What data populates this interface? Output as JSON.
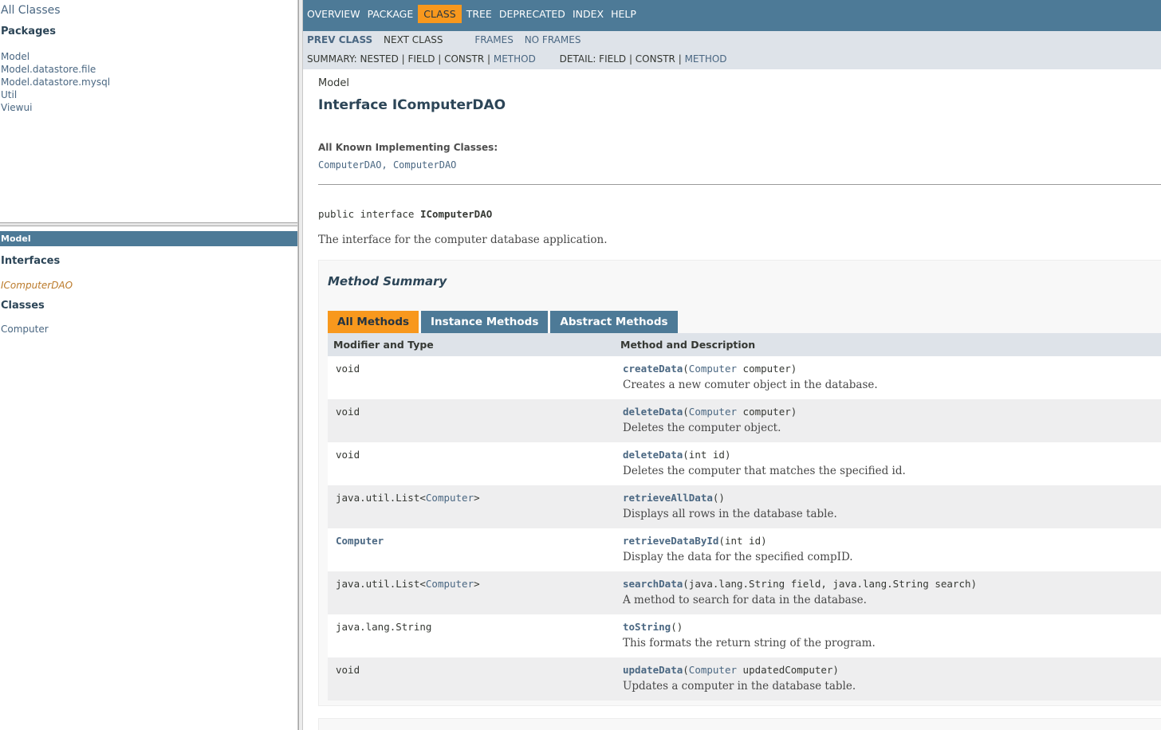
{
  "left": {
    "all_classes": "All Classes",
    "packages_title": "Packages",
    "packages": [
      "Model",
      "Model.datastore.file",
      "Model.datastore.mysql",
      "Util",
      "Viewui"
    ],
    "current_package": "Model",
    "interfaces_title": "Interfaces",
    "interfaces": [
      "IComputerDAO"
    ],
    "classes_title": "Classes",
    "classes": [
      "Computer"
    ]
  },
  "topnav": {
    "items": [
      "OVERVIEW",
      "PACKAGE",
      "CLASS",
      "TREE",
      "DEPRECATED",
      "INDEX",
      "HELP"
    ],
    "active": "CLASS"
  },
  "subnav": {
    "prev_class": "PREV CLASS",
    "next_class": "NEXT CLASS",
    "frames": "FRAMES",
    "no_frames": "NO FRAMES",
    "summary_prefix": "SUMMARY: NESTED | FIELD | CONSTR | ",
    "summary_method": "METHOD",
    "detail_prefix": "DETAIL: FIELD | CONSTR | ",
    "detail_method": "METHOD"
  },
  "header": {
    "package": "Model",
    "title": "Interface IComputerDAO",
    "impl_title": "All Known Implementing Classes:",
    "impl_class_1": "ComputerDAO",
    "impl_sep": ", ",
    "impl_class_2": "ComputerDAO"
  },
  "signature": {
    "prefix": "public interface ",
    "name": "IComputerDAO"
  },
  "description": "The interface for the computer database application.",
  "summary": {
    "title": "Method Summary",
    "tabs": [
      "All Methods",
      "Instance Methods",
      "Abstract Methods"
    ],
    "col_type": "Modifier and Type",
    "col_method": "Method and Description",
    "rows": [
      {
        "type_pre": "void",
        "type_link": "",
        "type_post": "",
        "name": "createData",
        "param_pre": "(",
        "param_link": "Computer",
        "param_post": " computer)",
        "desc": "Creates a new comuter object in the database."
      },
      {
        "type_pre": "void",
        "type_link": "",
        "type_post": "",
        "name": "deleteData",
        "param_pre": "(",
        "param_link": "Computer",
        "param_post": " computer)",
        "desc": "Deletes the computer object."
      },
      {
        "type_pre": "void",
        "type_link": "",
        "type_post": "",
        "name": "deleteData",
        "param_pre": "(int id)",
        "param_link": "",
        "param_post": "",
        "desc": "Deletes the computer that matches the specified id."
      },
      {
        "type_pre": "java.util.List<",
        "type_link": "Computer",
        "type_post": ">",
        "name": "retrieveAllData",
        "param_pre": "()",
        "param_link": "",
        "param_post": "",
        "desc": "Displays all rows in the database table."
      },
      {
        "type_pre": "",
        "type_link": "Computer",
        "type_post": "",
        "name": "retrieveDataById",
        "param_pre": "(int id)",
        "param_link": "",
        "param_post": "",
        "desc": "Display the data for the specified compID."
      },
      {
        "type_pre": "java.util.List<",
        "type_link": "Computer",
        "type_post": ">",
        "name": "searchData",
        "param_pre": "(java.lang.String field, java.lang.String search)",
        "param_link": "",
        "param_post": "",
        "desc": "A method to search for data in the database."
      },
      {
        "type_pre": "java.lang.String",
        "type_link": "",
        "type_post": "",
        "name": "toString",
        "param_pre": "()",
        "param_link": "",
        "param_post": "",
        "desc": "This formats the return string of the program."
      },
      {
        "type_pre": "void",
        "type_link": "",
        "type_post": "",
        "name": "updateData",
        "param_pre": "(",
        "param_link": "Computer",
        "param_post": " updatedComputer)",
        "desc": "Updates a computer in the database table."
      }
    ]
  },
  "colors": {
    "nav_blue": "#4d7a97",
    "active_orange": "#f8981d",
    "subnav_bg": "#dee3e9",
    "link": "#4a6782"
  }
}
